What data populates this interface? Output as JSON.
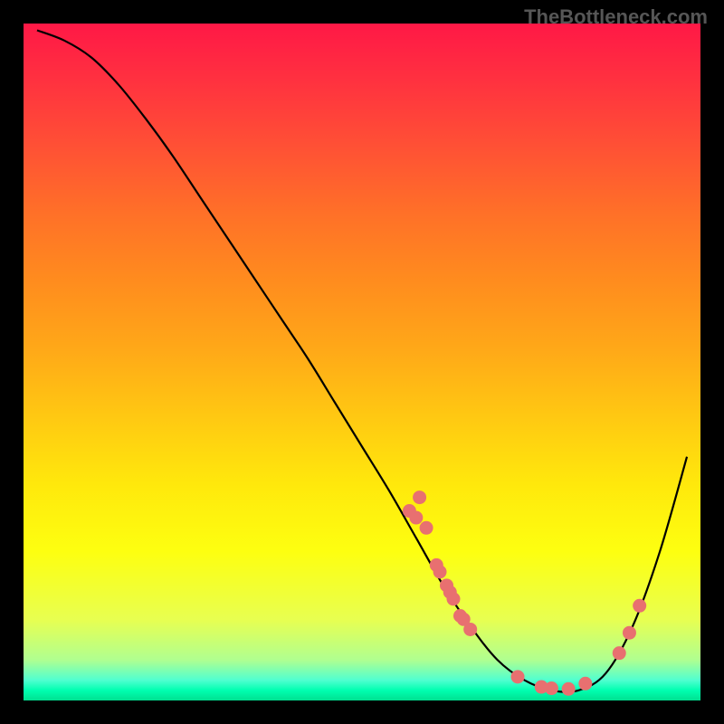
{
  "watermark": "TheBottleneck.com",
  "chart_data": {
    "type": "line",
    "title": "",
    "xlabel": "",
    "ylabel": "",
    "xlim": [
      0,
      100
    ],
    "ylim": [
      0,
      100
    ],
    "grid": false,
    "series": [
      {
        "name": "curve",
        "x": [
          2,
          6,
          10,
          14,
          18,
          22,
          26,
          30,
          34,
          38,
          42,
          46,
          50,
          54,
          58,
          62,
          66,
          70,
          74,
          78,
          82,
          86,
          90,
          94,
          98
        ],
        "values": [
          99,
          97.5,
          95,
          91,
          86,
          80.5,
          74.5,
          68.5,
          62.5,
          56.5,
          50.5,
          44,
          37.5,
          31,
          24,
          17,
          11,
          6,
          3,
          1.5,
          1.5,
          4,
          11,
          22,
          36
        ]
      }
    ],
    "scatter_points": {
      "name": "markers",
      "color": "#e87070",
      "points": [
        {
          "x": 57,
          "y": 28
        },
        {
          "x": 58,
          "y": 27
        },
        {
          "x": 58.5,
          "y": 30
        },
        {
          "x": 59.5,
          "y": 25.5
        },
        {
          "x": 61,
          "y": 20
        },
        {
          "x": 61.5,
          "y": 19
        },
        {
          "x": 62.5,
          "y": 17
        },
        {
          "x": 63,
          "y": 16
        },
        {
          "x": 63.5,
          "y": 15
        },
        {
          "x": 64.5,
          "y": 12.5
        },
        {
          "x": 65,
          "y": 12
        },
        {
          "x": 66,
          "y": 10.5
        },
        {
          "x": 73,
          "y": 3.5
        },
        {
          "x": 76.5,
          "y": 2
        },
        {
          "x": 78,
          "y": 1.8
        },
        {
          "x": 80.5,
          "y": 1.7
        },
        {
          "x": 83,
          "y": 2.5
        },
        {
          "x": 88,
          "y": 7
        },
        {
          "x": 89.5,
          "y": 10
        },
        {
          "x": 91,
          "y": 14
        }
      ]
    },
    "gradient": {
      "top_color": "#ff1846",
      "bottom_color": "#00e090"
    }
  }
}
